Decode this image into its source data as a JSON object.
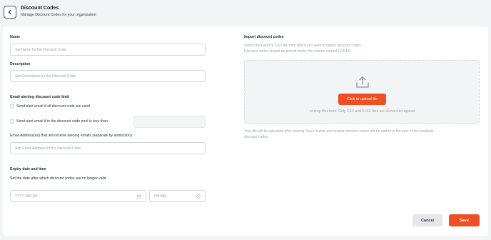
{
  "header": {
    "title": "Discount Codes",
    "subtitle": "Manage Discount Codes for your organization"
  },
  "form": {
    "name_label": "Name",
    "name_placeholder": "Set Name for the Discount Code",
    "description_label": "Description",
    "description_placeholder": "Add Description for the Discount Code",
    "alert_section_label": "Email alerting discount code limit",
    "alert_all_used_label": "Send alert email if all discount code are used",
    "alert_pool_less_label": "Send alert email if in the discount code pool is less than:",
    "email_label": "Email Address(es) that will receive alerting emails (separate by semicolon):",
    "email_placeholder": "Add Email Address for the Discount Code",
    "expiry_label": "Expiry date and time",
    "expiry_desc": "Set the date after which discount codes are no longer valid",
    "date_placeholder": "YYYY-MM-DD",
    "time_placeholder": "HH:MM"
  },
  "import": {
    "label": "Import discount codes",
    "desc_line1": "Select the Excel or CSV file from which you want to import discount codes.",
    "desc_line2": "Discount codes should be placed under the column named CODES.",
    "upload_button": "Click to upload file",
    "drop_text": "or drop files here. Only CSV and XLSX files are allowed for upload.",
    "note_line1": "Your file will be uploaded after clicking 'Save' button and unique discount codes will be added to the pool of the available",
    "note_line2": "discount codes"
  },
  "actions": {
    "cancel": "Cancel",
    "save": "Save"
  },
  "colors": {
    "accent": "#f04e23",
    "background": "#f3f4f6",
    "card": "#ffffff"
  },
  "icons": {
    "back": "chevron-left-icon",
    "upload": "upload-icon",
    "calendar": "calendar-icon",
    "clock": "clock-icon"
  }
}
